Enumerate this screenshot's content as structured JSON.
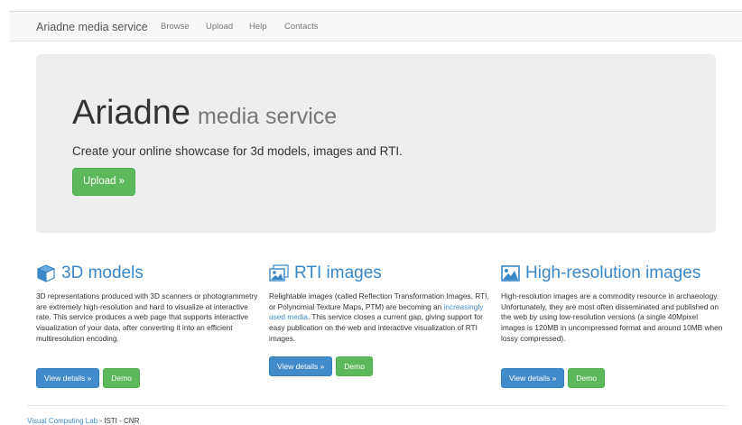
{
  "navbar": {
    "brand": "Ariadne media service",
    "links": [
      "Browse",
      "Upload",
      "Help",
      "Contacts"
    ]
  },
  "hero": {
    "title": "Ariadne",
    "subtitle": "media service",
    "lead": "Create your online showcase for 3d models, images and RTI.",
    "button": "Upload »"
  },
  "features": [
    {
      "icon": "cube-icon",
      "title": "3D models",
      "text": "3D representations produced with 3D scanners or photogrammetry are extremely high-resolution and hard to visualize at interactive rate. This service produces a web page that supports interactive visualization of your data, after converting it into an efficient multiresolution encoding.",
      "details": "View details »",
      "demo": "Demo"
    },
    {
      "icon": "rti-images-icon",
      "title": "RTI images",
      "text_before": "Relightable images (called Reflection Transformation Images, RTI, or Polynomial Texture Maps, PTM) are becoming an ",
      "link": "increasingly used media",
      "text_after": ". This service closes a current gap, giving support for easy publication on the web and interactive visualization of RTI images.",
      "details": "View details »",
      "demo": "Demo"
    },
    {
      "icon": "picture-icon",
      "title": "High-resolution images",
      "text": "High-resolution images are a commodity resource in archaeology. Unfortunately, they are most often disseminated and published on the web by using low-resolution versions (a single 40Mpixel images is 120MB in uncompressed format and around 10MB when lossy compressed).",
      "details": "View details »",
      "demo": "Demo"
    }
  ],
  "footer": {
    "link": "Visual Computing Lab",
    "text": " - ISTI - CNR"
  },
  "colors": {
    "primary": "#428bca",
    "success": "#5cb85c",
    "heading": "#3a87c8",
    "jumbotron": "#eeeeee"
  }
}
